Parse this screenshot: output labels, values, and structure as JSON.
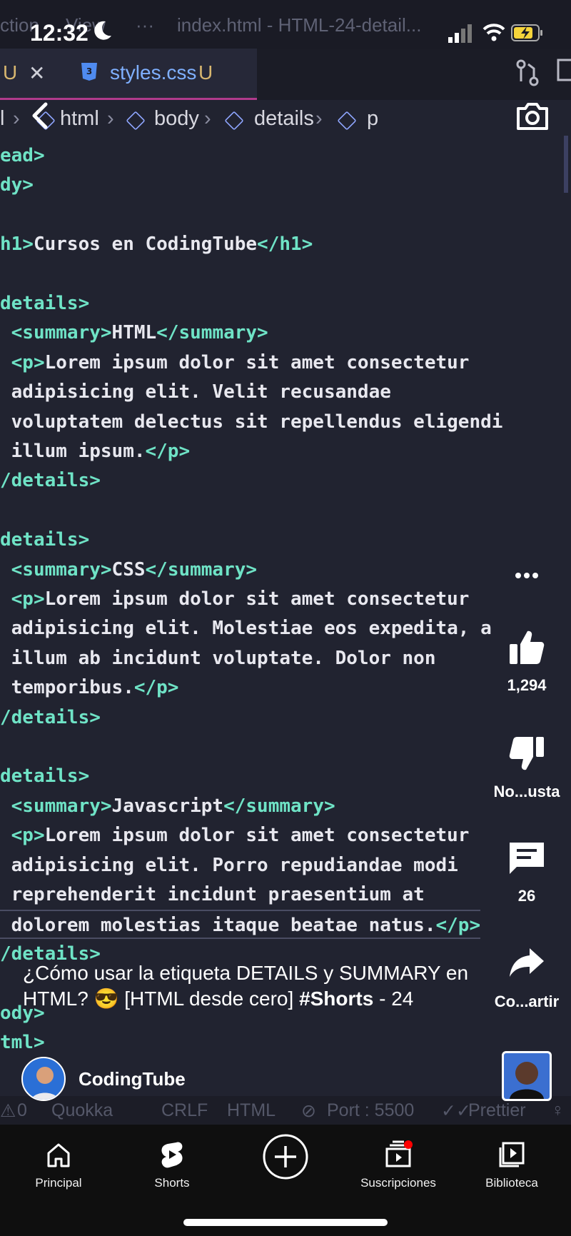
{
  "phone_status": {
    "time": "12:32"
  },
  "editor": {
    "menu_fragment": "ction",
    "menu_view": "View",
    "menu_dots": "···",
    "window_title": "index.html - HTML-24-detail...",
    "tab_left_badge": "U",
    "tab_css": "styles.css",
    "tab_css_badge": "U",
    "breadcrumb": [
      "l",
      "html",
      "body",
      "details",
      "p"
    ],
    "code_lines": [
      {
        "pre": "",
        "tag": "ead>",
        "post": ""
      },
      {
        "pre": "",
        "tag": "dy>",
        "post": ""
      },
      {
        "pre": "",
        "tag": "",
        "post": ""
      },
      {
        "pre": "",
        "tag": "h1>",
        "post": "Cursos en CodingTube",
        "tag2": "</h1>"
      },
      {
        "pre": "",
        "tag": "",
        "post": ""
      },
      {
        "pre": "",
        "tag": "details>",
        "post": ""
      },
      {
        "pre": " ",
        "tag": "<summary>",
        "post": "HTML",
        "tag2": "</summary>"
      },
      {
        "pre": " ",
        "tag": "<p>",
        "post": "Lorem ipsum dolor sit amet consectetur"
      },
      {
        "pre": " ",
        "tag": "",
        "post": "adipisicing elit. Velit recusandae"
      },
      {
        "pre": " ",
        "tag": "",
        "post": "voluptatem delectus sit repellendus eligendi"
      },
      {
        "pre": " ",
        "tag": "",
        "post": "illum ipsum.",
        "tag2": "</p>"
      },
      {
        "pre": "",
        "tag": "/details>",
        "post": ""
      },
      {
        "pre": "",
        "tag": "",
        "post": ""
      },
      {
        "pre": "",
        "tag": "details>",
        "post": ""
      },
      {
        "pre": " ",
        "tag": "<summary>",
        "post": "CSS",
        "tag2": "</summary>"
      },
      {
        "pre": " ",
        "tag": "<p>",
        "post": "Lorem ipsum dolor sit amet consectetur"
      },
      {
        "pre": " ",
        "tag": "",
        "post": "adipisicing elit. Molestiae eos expedita, a"
      },
      {
        "pre": " ",
        "tag": "",
        "post": "illum ab incidunt voluptate. Dolor non"
      },
      {
        "pre": " ",
        "tag": "",
        "post": "temporibus.",
        "tag2": "</p>"
      },
      {
        "pre": "",
        "tag": "/details>",
        "post": ""
      },
      {
        "pre": "",
        "tag": "",
        "post": ""
      },
      {
        "pre": "",
        "tag": "details>",
        "post": ""
      },
      {
        "pre": " ",
        "tag": "<summary>",
        "post": "Javascript",
        "tag2": "</summary>"
      },
      {
        "pre": " ",
        "tag": "<p>",
        "post": "Lorem ipsum dolor sit amet consectetur"
      },
      {
        "pre": " ",
        "tag": "",
        "post": "adipisicing elit. Porro repudiandae modi"
      },
      {
        "pre": " ",
        "tag": "",
        "post": "reprehenderit incidunt praesentium at"
      },
      {
        "pre": " ",
        "tag": "",
        "post": "dolorem molestias itaque beatae natus.",
        "tag2": "</p>"
      },
      {
        "pre": "",
        "tag": "/details>",
        "post": ""
      },
      {
        "pre": "",
        "tag": "",
        "post": ""
      },
      {
        "pre": "",
        "tag": "ody>",
        "post": ""
      },
      {
        "pre": "",
        "tag": "tml>",
        "post": ""
      }
    ],
    "status": {
      "warnings": "0",
      "quokka": "Quokka",
      "eol": "CRLF",
      "language": "HTML",
      "port": "Port : 5500",
      "prettier": "Prettier"
    }
  },
  "short": {
    "title_part1": "¿Cómo usar la etiqueta DETAILS y SUMMARY en HTML? 😎  [HTML desde cero] ",
    "title_hashtag": "#Shorts",
    "title_part2": " - 24",
    "channel": "CodingTube",
    "likes": "1,294",
    "dislike_label": "No...usta",
    "comments": "26",
    "share_label": "Co...artir"
  },
  "bottom_nav": {
    "items": [
      "Principal",
      "Shorts",
      "Suscripciones",
      "Biblioteca"
    ]
  },
  "colors": {
    "tag": "#6fe3c6",
    "code_bg": "#212330",
    "nav_bg": "#0f0f0f",
    "notification": "#ff0000"
  }
}
